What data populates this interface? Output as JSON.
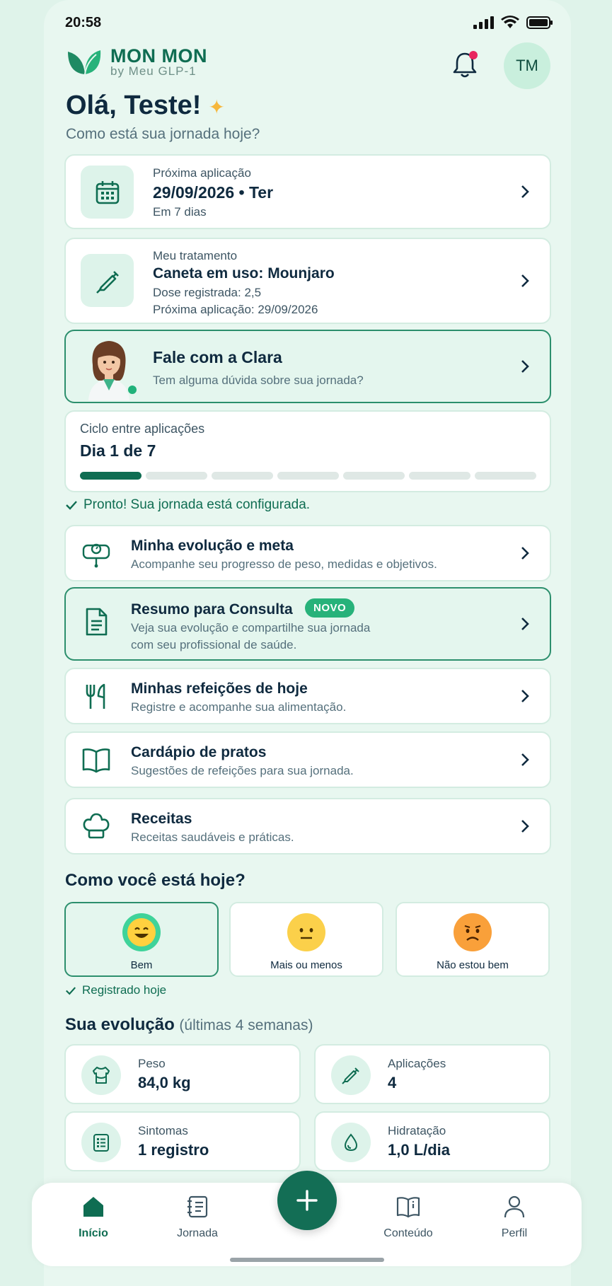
{
  "status": {
    "time": "20:58"
  },
  "brand": {
    "name": "MON MON",
    "tagline": "by Meu GLP-1"
  },
  "user": {
    "initials": "TM"
  },
  "greeting": {
    "title": "Olá, Teste!",
    "subtitle": "Como está sua jornada hoje?"
  },
  "next_application": {
    "label": "Próxima aplicação",
    "date": "29/09/2026 • Ter",
    "countdown": "Em 7 dias"
  },
  "treatment": {
    "label": "Meu tratamento",
    "pen": "Caneta em uso: Mounjaro",
    "dose": "Dose registrada: 2,5",
    "next": "Próxima aplicação: 29/09/2026"
  },
  "clara": {
    "title": "Fale com a Clara",
    "subtitle": "Tem alguma dúvida sobre sua jornada?"
  },
  "cycle": {
    "label": "Ciclo entre aplicações",
    "day": "Dia 1 de 7",
    "current": 1,
    "total": 7
  },
  "ready_message": "Pronto! Sua jornada está configurada.",
  "menu": [
    {
      "title": "Minha evolução e meta",
      "subtitle": "Acompanhe seu progresso de peso, medidas e objetivos."
    },
    {
      "title": "Resumo para Consulta",
      "badge": "NOVO",
      "subtitle_1": "Veja sua evolução e compartilhe sua jornada",
      "subtitle_2": "com seu profissional de saúde."
    },
    {
      "title": "Minhas refeições de hoje",
      "subtitle": "Registre e acompanhe sua alimentação."
    },
    {
      "title": "Cardápio de pratos",
      "subtitle": "Sugestões de refeições para sua jornada."
    },
    {
      "title": "Receitas",
      "subtitle": "Receitas saudáveis e práticas."
    }
  ],
  "mood": {
    "title": "Como você está hoje?",
    "options": [
      {
        "label": "Bem",
        "selected": true
      },
      {
        "label": "Mais ou menos",
        "selected": false
      },
      {
        "label": "Não estou bem",
        "selected": false
      }
    ],
    "registered": "Registrado hoje"
  },
  "evolution": {
    "title": "Sua evolução",
    "period": "(últimas 4 semanas)",
    "stats": [
      {
        "label": "Peso",
        "value": "84,0 kg"
      },
      {
        "label": "Aplicações",
        "value": "4"
      },
      {
        "label": "Sintomas",
        "value": "1 registro"
      },
      {
        "label": "Hidratação",
        "value": "1,0 L/dia"
      }
    ]
  },
  "nav": [
    {
      "label": "Início",
      "active": true
    },
    {
      "label": "Jornada",
      "active": false
    },
    {
      "label": "Conteúdo",
      "active": false
    },
    {
      "label": "Perfil",
      "active": false
    }
  ],
  "colors": {
    "brand": "#0f6d52",
    "accent": "#27b27a",
    "notification": "#e8265f"
  }
}
